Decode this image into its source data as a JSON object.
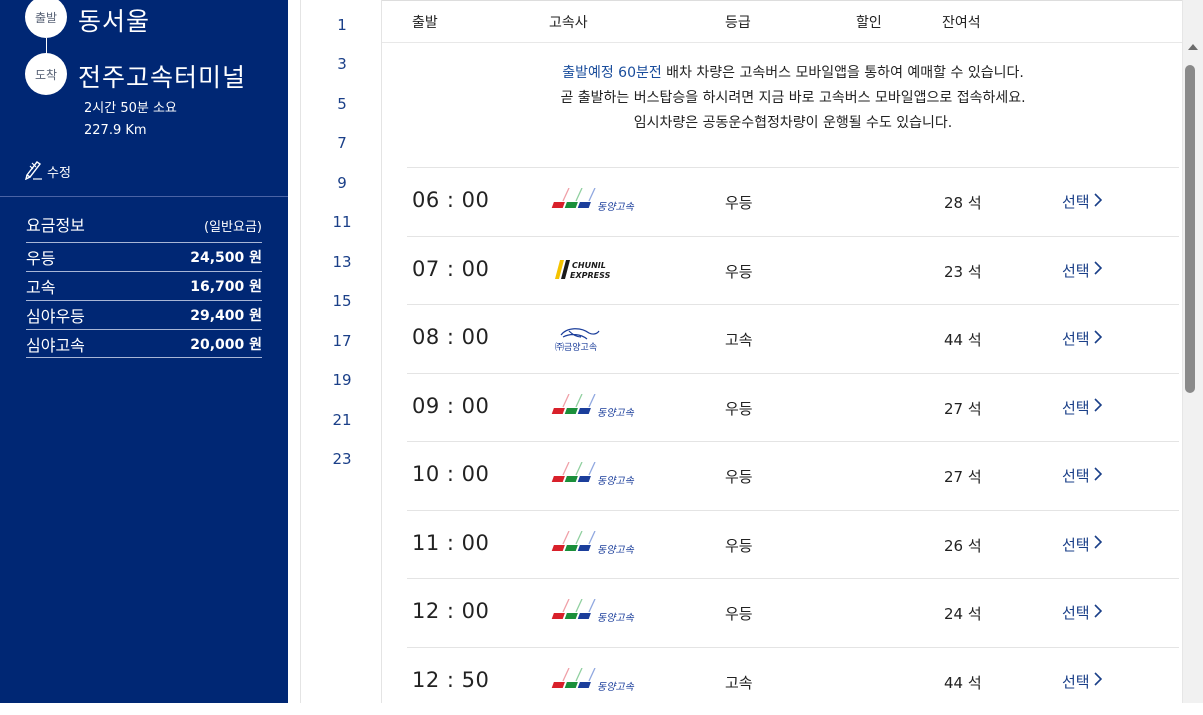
{
  "route": {
    "depart_tag": "출발",
    "depart_city": "동서울",
    "arrive_tag": "도착",
    "arrive_city": "전주고속터미널",
    "duration": "2시간 50분 소요",
    "distance": "227.9 Km",
    "edit_label": "수정"
  },
  "fare": {
    "title": "요금정보",
    "subtitle": "(일반요금)",
    "rows": [
      {
        "name": "우등",
        "price": "24,500 원"
      },
      {
        "name": "고속",
        "price": "16,700 원"
      },
      {
        "name": "심야우등",
        "price": "29,400 원"
      },
      {
        "name": "심야고속",
        "price": "20,000 원"
      }
    ]
  },
  "hours": [
    "1",
    "3",
    "5",
    "7",
    "9",
    "11",
    "13",
    "15",
    "17",
    "19",
    "21",
    "23"
  ],
  "table_header": {
    "depart": "출발",
    "company": "고속사",
    "grade": "등급",
    "discount": "할인",
    "seats": "잔여석"
  },
  "notice": {
    "line1_highlight": "출발예정 60분전",
    "line1_rest": " 배차 차량은 고속버스 모바일앱을 통하여 예매할 수 있습니다.",
    "line2": "곧 출발하는 버스탑승을 하시려면 지금 바로 고속버스 모바일앱으로 접속하세요.",
    "line3": "임시차량은 공동운수협정차량이 운행될 수도 있습니다."
  },
  "logos": {
    "dongyang_text": "동양고속",
    "chunil_line1": "CHUNIL",
    "chunil_line2": "EXPRESS",
    "geumho_text": "㈜금양고속"
  },
  "schedule": [
    {
      "time": "06 : 00",
      "company": "dongyang",
      "grade": "우등",
      "seats": "28 석",
      "select": "선택"
    },
    {
      "time": "07 : 00",
      "company": "chunil",
      "grade": "우등",
      "seats": "23 석",
      "select": "선택"
    },
    {
      "time": "08 : 00",
      "company": "geumho",
      "grade": "고속",
      "seats": "44 석",
      "select": "선택"
    },
    {
      "time": "09 : 00",
      "company": "dongyang",
      "grade": "우등",
      "seats": "27 석",
      "select": "선택"
    },
    {
      "time": "10 : 00",
      "company": "dongyang",
      "grade": "우등",
      "seats": "27 석",
      "select": "선택"
    },
    {
      "time": "11 : 00",
      "company": "dongyang",
      "grade": "우등",
      "seats": "26 석",
      "select": "선택"
    },
    {
      "time": "12 : 00",
      "company": "dongyang",
      "grade": "우등",
      "seats": "24 석",
      "select": "선택"
    },
    {
      "time": "12 : 50",
      "company": "dongyang",
      "grade": "고속",
      "seats": "44 석",
      "select": "선택"
    }
  ],
  "colors": {
    "panel": "#002774",
    "link": "#1a3f88"
  }
}
